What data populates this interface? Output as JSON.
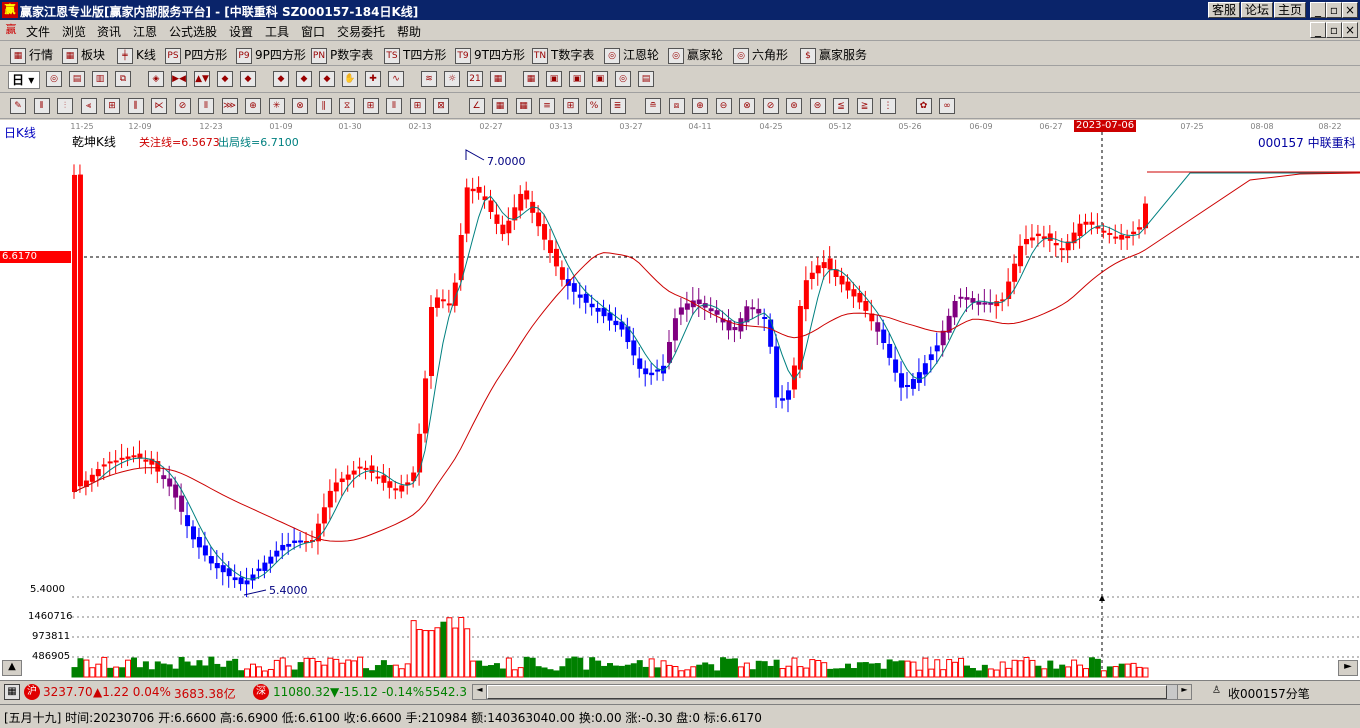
{
  "window": {
    "logo_glyph": "赢",
    "title": "赢家江恩专业版[赢家内部服务平台] - [中联重科   SZ000157-184日K线]",
    "buttons": [
      "客服",
      "论坛",
      "主页"
    ],
    "controls": [
      "_",
      "▫",
      "×"
    ]
  },
  "menu": {
    "items": [
      "文件",
      "浏览",
      "资讯",
      "江恩",
      "公式选股",
      "设置",
      "工具",
      "窗口",
      "交易委托",
      "帮助"
    ]
  },
  "toolbar1": {
    "items": [
      {
        "icon": "table-icon",
        "glyph": "▦",
        "label": "行情"
      },
      {
        "icon": "grid-icon",
        "glyph": "▦",
        "label": "板块"
      },
      {
        "icon": "candle-icon",
        "glyph": "╪",
        "label": "K线"
      },
      {
        "icon": "p-icon",
        "glyph": "PS",
        "label": "P四方形"
      },
      {
        "icon": "p9-icon",
        "glyph": "P9",
        "label": "9P四方形"
      },
      {
        "icon": "pn-icon",
        "glyph": "PN",
        "label": "P数字表"
      },
      {
        "icon": "ts-icon",
        "glyph": "TS",
        "label": "T四方形"
      },
      {
        "icon": "t9-icon",
        "glyph": "T9",
        "label": "9T四方形"
      },
      {
        "icon": "tn-icon",
        "glyph": "TN",
        "label": "T数字表"
      },
      {
        "icon": "wheel-icon",
        "glyph": "◎",
        "label": "江恩轮"
      },
      {
        "icon": "wheel2-icon",
        "glyph": "◎",
        "label": "赢家轮"
      },
      {
        "icon": "hexagon-icon",
        "glyph": "◎",
        "label": "六角形"
      },
      {
        "icon": "dollar-icon",
        "glyph": "$",
        "label": "赢家服务"
      }
    ]
  },
  "toolbar2": {
    "period_label": "日"
  },
  "chart": {
    "period_tag": "日K线",
    "indicator_name": "乾坤K线",
    "attention_line": "关注线=6.5673",
    "exit_line": "出局线=6.7100",
    "stock_label": "000157  中联重科",
    "high_label": "7.0000",
    "low_label": "5.4000",
    "price_tag": "6.6170",
    "price_axis_label": "5.4000",
    "cursor_date": "2023-07-06",
    "date_ticks": [
      "11-25",
      "12-09",
      "12-23",
      "01-09",
      "01-30",
      "02-13",
      "02-27",
      "03-13",
      "03-27",
      "04-11",
      "04-25",
      "05-12",
      "05-26",
      "06-09",
      "06-27",
      "2023-07-06",
      "07-25",
      "08-08",
      "08-22"
    ],
    "volume_ticks": [
      "1460716",
      "973811",
      "486905"
    ],
    "colors": {
      "up": "#ff0000",
      "down": "#0000ff",
      "mid": "#800080",
      "ma_short": "#008080",
      "ma_long": "#cc0000",
      "volume_up": "#ff0000",
      "volume_down": "#008000"
    }
  },
  "status1": {
    "sh_icon": "沪",
    "sh_index": "3237.70",
    "sh_change": "▲1.22 0.04%",
    "sh_amount": "3683.38亿",
    "sz_icon": "深",
    "sz_index": "11080.32",
    "sz_change": "▼-15.12 -0.14%",
    "sz_amount": "5542.3",
    "right_text": "收000157分笔"
  },
  "status2": {
    "text": "[五月十九] 时间:20230706 开:6.6600 高:6.6900 低:6.6100 收:6.6600 手:210984 额:140363040.00 换:0.00 涨:-0.30 盘:0 标:6.6170"
  }
}
